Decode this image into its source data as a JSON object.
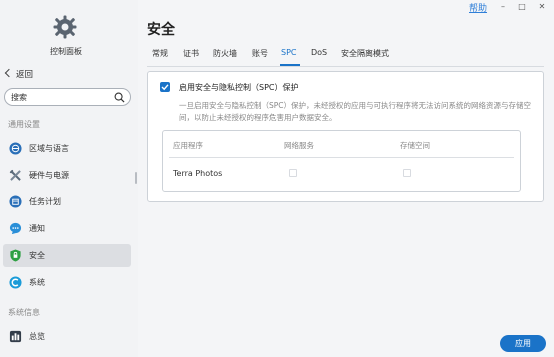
{
  "titlebar": {
    "help": "帮助",
    "minimize": "–",
    "maximize": "□",
    "close": "✕"
  },
  "sidebar": {
    "title": "控制面板",
    "back_label": "返回",
    "search_placeholder": "搜索",
    "section_general": "通用设置",
    "section_system_info": "系统信息",
    "items": [
      {
        "label": "区域与语言",
        "icon": "globe-icon",
        "color": "#2a6fb8"
      },
      {
        "label": "硬件与电源",
        "icon": "tools-icon",
        "color": "#5a6a7a"
      },
      {
        "label": "任务计划",
        "icon": "calendar-icon",
        "color": "#2a6fb8"
      },
      {
        "label": "通知",
        "icon": "chat-bubble-icon",
        "color": "#2a8fd8"
      },
      {
        "label": "安全",
        "icon": "shield-icon",
        "color": "#2ea043"
      },
      {
        "label": "系统",
        "icon": "system-icon",
        "color": "#1a9bd8"
      },
      {
        "label": "总览",
        "icon": "overview-icon",
        "color": "#333d4a"
      }
    ],
    "active_item": "安全"
  },
  "main": {
    "title": "安全",
    "tabs": [
      "常规",
      "证书",
      "防火墙",
      "账号",
      "SPC",
      "DoS",
      "安全隔离模式"
    ],
    "active_tab": "SPC",
    "spc": {
      "checkbox_label": "启用安全与隐私控制（SPC）保护",
      "checked": true,
      "description": "一旦启用安全与隐私控制（SPC）保护，未经授权的应用与可执行程序将无法访问系统的网络资源与存储空间，以防止未经授权的程序危害用户数据安全。",
      "table": {
        "headers": [
          "应用程序",
          "网络服务",
          "存储空间"
        ],
        "rows": [
          {
            "app": "Terra Photos",
            "network": false,
            "storage": false
          }
        ]
      }
    }
  },
  "footer": {
    "apply_label": "应用"
  },
  "colors": {
    "accent": "#1a73c8",
    "sidebar_bg": "#f2f3f5",
    "active_bg": "#dcdee2"
  }
}
